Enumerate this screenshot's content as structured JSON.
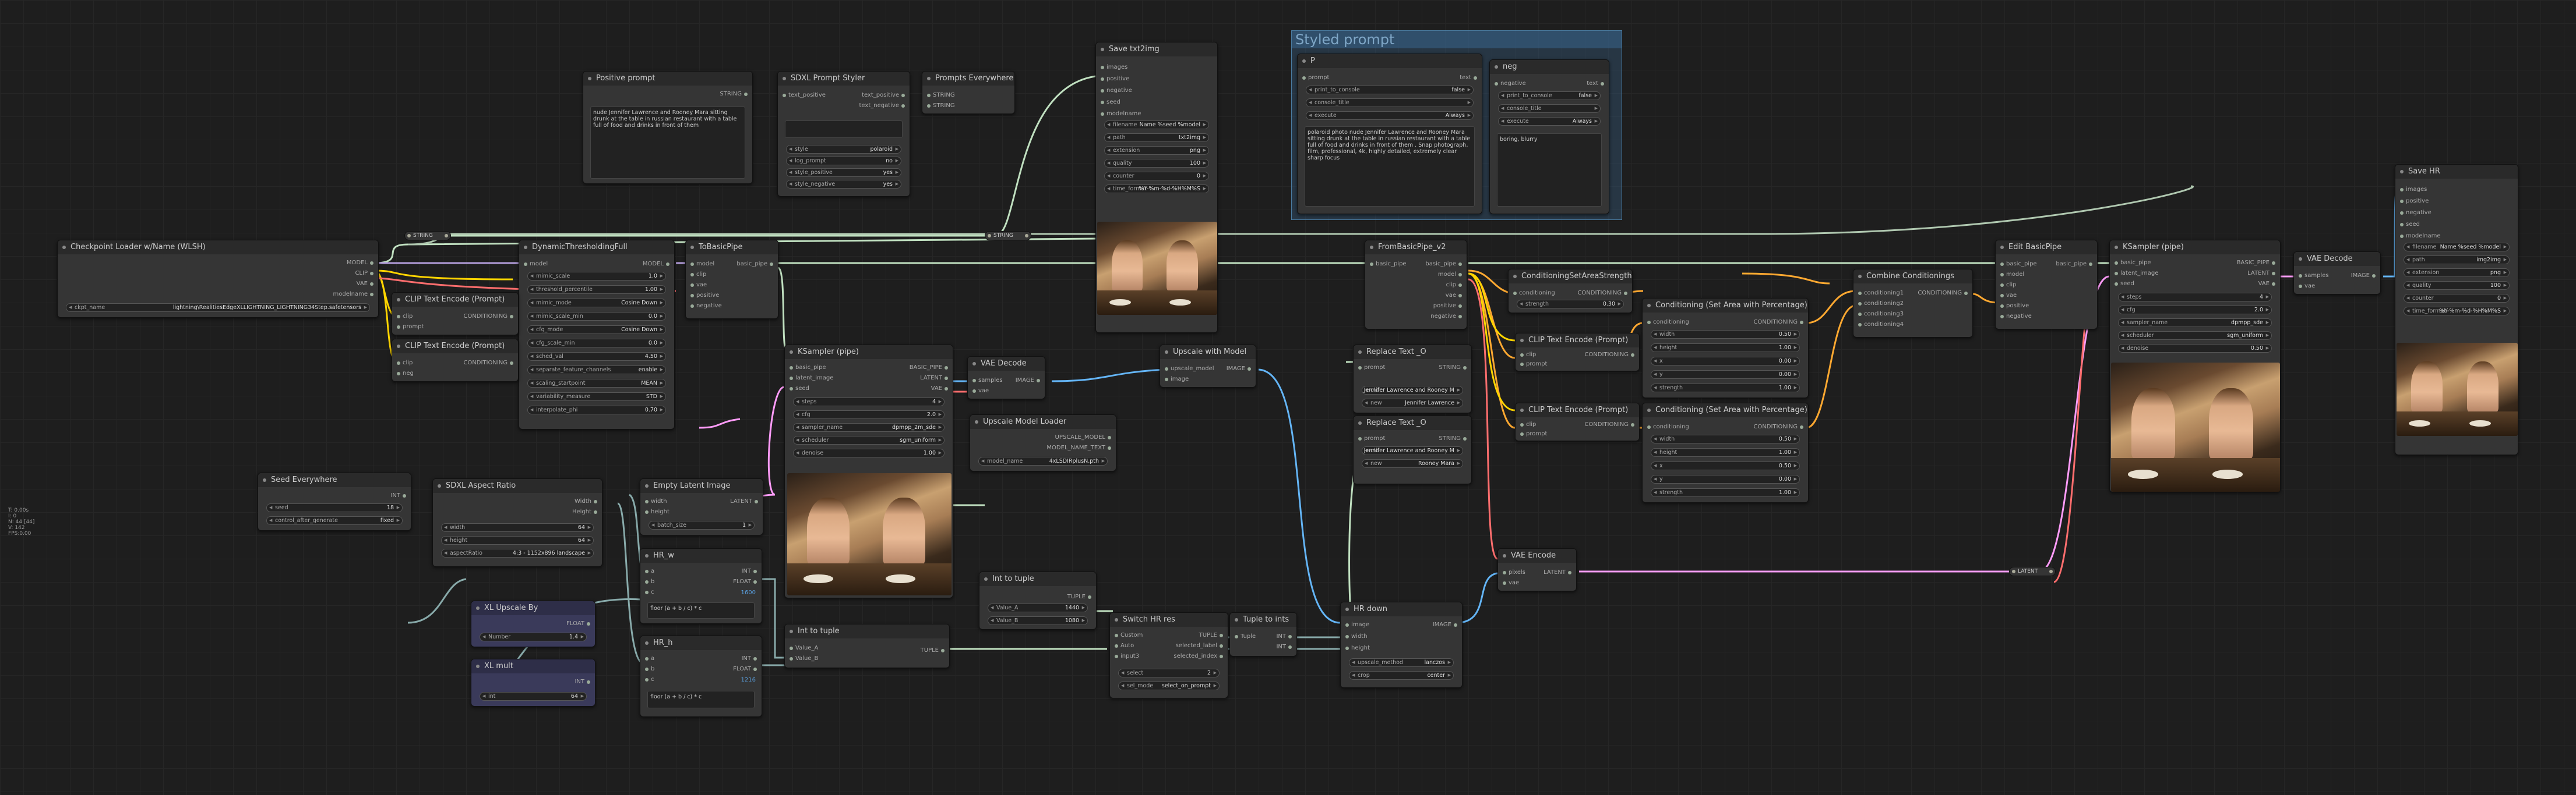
{
  "stats": [
    "T: 0.00s",
    "I: 0",
    "N: 44 [44]",
    "V: 142",
    "FPS:0.00"
  ],
  "group": {
    "title": "Styled prompt"
  },
  "nodes": {
    "checkpoint": {
      "title": "Checkpoint Loader w/Name (WLSH)",
      "outs": [
        "MODEL",
        "CLIP",
        "VAE",
        "modelname"
      ],
      "ckpt_label": "ckpt_name",
      "ckpt_value": "lightning\\RealitiesEdgeXLLIGHTNING_LIGHTNING34Step.safetensors"
    },
    "pos_prompt": {
      "title": "Positive prompt",
      "out": "STRING",
      "text": "nude Jennifer Lawrence and Rooney Mara sitting drunk at the table in russian restaurant with a table full of food and drinks in front of them"
    },
    "sdxl_styler": {
      "title": "SDXL Prompt Styler",
      "ins": [
        "text_positive",
        "text_negative"
      ],
      "outs": [
        "text_positive",
        "text_negative"
      ],
      "widgets": [
        [
          "style",
          "polaroid"
        ],
        [
          "log_prompt",
          "no"
        ],
        [
          "style_positive",
          "yes"
        ],
        [
          "style_negative",
          "yes"
        ]
      ]
    },
    "prompts_everywhere": {
      "title": "Prompts Everywhere",
      "ins": [
        "STRING",
        "STRING"
      ]
    },
    "save_left": {
      "title": "Save txt2img",
      "ins": [
        "images",
        "positive",
        "negative",
        "seed",
        "modelname"
      ],
      "widgets": [
        [
          "filename",
          "Name %seed %model"
        ],
        [
          "path",
          "txt2img"
        ],
        [
          "extension",
          "png"
        ],
        [
          "quality",
          "100"
        ],
        [
          "counter",
          "0"
        ],
        [
          "time_format",
          "%Y-%m-%d-%H%M%S"
        ]
      ]
    },
    "p_node": {
      "title": "P",
      "in": "prompt",
      "out": "text",
      "widgets": [
        [
          "print_to_console",
          "false"
        ],
        [
          "console_title",
          ""
        ],
        [
          "execute",
          "Always"
        ]
      ],
      "text": "polaroid photo nude Jennifer Lawrence and Rooney Mara sitting drunk at the table in russian restaurant with a table full of food and drinks in front of them . Snap photograph, film, professional, 4k, highly detailed, extremely clear sharp focus"
    },
    "neg_node": {
      "title": "neg",
      "in": "negative",
      "out": "text",
      "widgets": [
        [
          "print_to_console",
          "false"
        ],
        [
          "console_title",
          ""
        ],
        [
          "execute",
          "Always"
        ]
      ],
      "text": "boring, blurry"
    },
    "save_hr": {
      "title": "Save HR",
      "ins": [
        "images",
        "positive",
        "negative",
        "seed",
        "modelname"
      ],
      "widgets": [
        [
          "filename",
          "Name %seed %model"
        ],
        [
          "path",
          "img2img"
        ],
        [
          "extension",
          "png"
        ],
        [
          "quality",
          "100"
        ],
        [
          "counter",
          "0"
        ],
        [
          "time_format",
          "%Y-%m-%d-%H%M%S"
        ]
      ]
    },
    "dyn_thresh": {
      "title": "DynamicThresholdingFull",
      "in": "model",
      "out": "MODEL",
      "widgets": [
        [
          "mimic_scale",
          "1.0"
        ],
        [
          "threshold_percentile",
          "1.00"
        ],
        [
          "mimic_mode",
          "Cosine Down"
        ],
        [
          "mimic_scale_min",
          "0.0"
        ],
        [
          "cfg_mode",
          "Cosine Down"
        ],
        [
          "cfg_scale_min",
          "0.0"
        ],
        [
          "sched_val",
          "4.50"
        ],
        [
          "separate_feature_channels",
          "enable"
        ],
        [
          "scaling_startpoint",
          "MEAN"
        ],
        [
          "variability_measure",
          "STD"
        ],
        [
          "interpolate_phi",
          "0.70"
        ]
      ]
    },
    "to_basic": {
      "title": "ToBasicPipe",
      "ins": [
        "model",
        "clip",
        "vae",
        "positive",
        "negative"
      ],
      "out": "basic_pipe"
    },
    "clip_pos": {
      "title": "CLIP Text Encode (Prompt)",
      "ins": [
        "clip",
        "prompt"
      ],
      "out": "CONDITIONING"
    },
    "clip_neg": {
      "title": "CLIP Text Encode (Prompt)",
      "ins": [
        "clip",
        "neg"
      ],
      "out": "CONDITIONING"
    },
    "ksampler1": {
      "title": "KSampler (pipe)",
      "ins": [
        "basic_pipe",
        "latent_image",
        "seed"
      ],
      "outs": [
        "BASIC_PIPE",
        "LATENT",
        "VAE"
      ],
      "widgets": [
        [
          "steps",
          "4"
        ],
        [
          "cfg",
          "2.0"
        ],
        [
          "sampler_name",
          "dpmpp_2m_sde"
        ],
        [
          "scheduler",
          "sgm_uniform"
        ],
        [
          "denoise",
          "1.00"
        ]
      ]
    },
    "vae_decode1": {
      "title": "VAE Decode",
      "ins": [
        "samples",
        "vae"
      ],
      "out": "IMAGE"
    },
    "upscale_model": {
      "title": "Upscale with Model",
      "ins": [
        "upscale_model",
        "image"
      ],
      "out": "IMAGE"
    },
    "upscale_loader": {
      "title": "Upscale Model Loader",
      "outs": [
        "UPSCALE_MODEL",
        "MODEL_NAME_TEXT"
      ],
      "widgets": [
        [
          "model_name",
          "4xLSDIRplusN.pth"
        ]
      ]
    },
    "from_basic": {
      "title": "FromBasicPipe_v2",
      "in": "basic_pipe",
      "outs": [
        "basic_pipe",
        "model",
        "clip",
        "vae",
        "positive",
        "negative"
      ]
    },
    "cond_strength": {
      "title": "ConditioningSetAreaStrength",
      "in": "conditioning",
      "out": "CONDITIONING",
      "widgets": [
        [
          "strength",
          "0.30"
        ]
      ]
    },
    "combine_cond": {
      "title": "Combine Conditionings",
      "ins": [
        "conditioning1",
        "conditioning2",
        "conditioning3",
        "conditioning4"
      ],
      "out": "CONDITIONING"
    },
    "edit_basic": {
      "title": "Edit BasicPipe",
      "ins": [
        "basic_pipe",
        "model",
        "clip",
        "vae",
        "positive",
        "negative"
      ],
      "out": "basic_pipe"
    },
    "ksampler2": {
      "title": "KSampler (pipe)",
      "ins": [
        "basic_pipe",
        "latent_image",
        "seed"
      ],
      "outs": [
        "BASIC_PIPE",
        "LATENT",
        "VAE"
      ],
      "widgets": [
        [
          "steps",
          "4"
        ],
        [
          "cfg",
          "2.0"
        ],
        [
          "sampler_name",
          "dpmpp_sde"
        ],
        [
          "scheduler",
          "sgm_uniform"
        ],
        [
          "denoise",
          "0.50"
        ]
      ]
    },
    "vae_decode2": {
      "title": "VAE Decode",
      "ins": [
        "samples",
        "vae"
      ],
      "out": "IMAGE"
    },
    "cond_area1": {
      "title": "Conditioning (Set Area with Percentage)",
      "in": "conditioning",
      "out": "CONDITIONING",
      "widgets": [
        [
          "width",
          "0.50"
        ],
        [
          "height",
          "1.00"
        ],
        [
          "x",
          "0.00"
        ],
        [
          "y",
          "0.00"
        ],
        [
          "strength",
          "1.00"
        ]
      ]
    },
    "cond_area2": {
      "title": "Conditioning (Set Area with Percentage)",
      "in": "conditioning",
      "out": "CONDITIONING",
      "widgets": [
        [
          "width",
          "0.50"
        ],
        [
          "height",
          "1.00"
        ],
        [
          "x",
          "0.50"
        ],
        [
          "y",
          "0.00"
        ],
        [
          "strength",
          "1.00"
        ]
      ]
    },
    "clip_p1": {
      "title": "CLIP Text Encode (Prompt)",
      "ins": [
        "clip",
        "prompt"
      ],
      "out": "CONDITIONING"
    },
    "clip_p2": {
      "title": "CLIP Text Encode (Prompt)",
      "ins": [
        "clip",
        "prompt"
      ],
      "out": "CONDITIONING"
    },
    "replace1": {
      "title": "Replace Text _O",
      "in": "prompt",
      "out": "STRING",
      "widgets": [
        [
          "old",
          "Jennifer Lawrence and Rooney M"
        ],
        [
          "new",
          "Jennifer Lawrence"
        ]
      ]
    },
    "replace2": {
      "title": "Replace Text _O",
      "in": "prompt",
      "out": "STRING",
      "widgets": [
        [
          "old",
          "Jennifer Lawrence and Rooney M"
        ],
        [
          "new",
          "Rooney Mara"
        ]
      ]
    },
    "seed": {
      "title": "Seed Everywhere",
      "out": "INT",
      "widgets": [
        [
          "seed",
          "18"
        ],
        [
          "control_after_generate",
          "fixed"
        ]
      ]
    },
    "sdxl_ratio": {
      "title": "SDXL Aspect Ratio",
      "outs": [
        "Width",
        "Height"
      ],
      "widgets": [
        [
          "width",
          "64"
        ],
        [
          "height",
          "64"
        ],
        [
          "aspectRatio",
          "4:3 - 1152x896 landscape"
        ]
      ]
    },
    "empty_latent": {
      "title": "Empty Latent Image",
      "ins": [
        "width",
        "height"
      ],
      "out": "LATENT",
      "widgets": [
        [
          "batch_size",
          "1"
        ]
      ]
    },
    "hr_w": {
      "title": "HR_w",
      "ins": [
        "a",
        "b",
        "c"
      ],
      "outs": [
        "INT",
        "FLOAT"
      ],
      "val": "1600",
      "expr": "floor (a + b / c) * c"
    },
    "hr_h": {
      "title": "HR_h",
      "ins": [
        "a",
        "b",
        "c"
      ],
      "outs": [
        "INT",
        "FLOAT"
      ],
      "val": "1216",
      "expr": "floor (a + b / c) * c"
    },
    "xl_upscale": {
      "title": "XL Upscale By",
      "out": "FLOAT",
      "widgets": [
        [
          "Number",
          "1.4"
        ]
      ]
    },
    "xl_mult": {
      "title": "XL mult",
      "out": "INT",
      "widgets": [
        [
          "int",
          "64"
        ]
      ]
    },
    "int_tuple1": {
      "title": "Int to tuple",
      "out": "TUPLE",
      "widgets": [
        [
          "Value_A",
          "1440"
        ],
        [
          "Value_B",
          "1080"
        ]
      ]
    },
    "int_tuple2": {
      "title": "Int to tuple",
      "ins": [
        "Value_A",
        "Value_B"
      ],
      "out": "TUPLE"
    },
    "switch_hr": {
      "title": "Switch HR res",
      "ins": [
        "Custom",
        "Auto",
        "input3"
      ],
      "outs": [
        "TUPLE",
        "selected_label",
        "selected_index"
      ],
      "widgets": [
        [
          "select",
          "2"
        ],
        [
          "sel_mode",
          "select_on_prompt"
        ]
      ]
    },
    "tuple_ints": {
      "title": "Tuple to ints",
      "in": "Tuple",
      "outs": [
        "INT",
        "INT"
      ]
    },
    "hr_down": {
      "title": "HR down",
      "ins": [
        "image",
        "width",
        "height"
      ],
      "out": "IMAGE",
      "widgets": [
        [
          "upscale_method",
          "lanczos"
        ],
        [
          "crop",
          "center"
        ]
      ]
    },
    "vae_encode": {
      "title": "VAE Encode",
      "ins": [
        "pixels",
        "vae"
      ],
      "out": "LATENT"
    }
  },
  "reroutes": {
    "string1": "STRING",
    "string2": "STRING",
    "latent1": "LATENT"
  },
  "colors": {
    "model": "#b39ddb",
    "clip": "#ffd500",
    "vae": "#ff6e6e",
    "cond": "#ffa931",
    "latent": "#ff9cf9",
    "image": "#64b5f6",
    "pipe": "#c0ffc0",
    "int": "#8aa"
  }
}
